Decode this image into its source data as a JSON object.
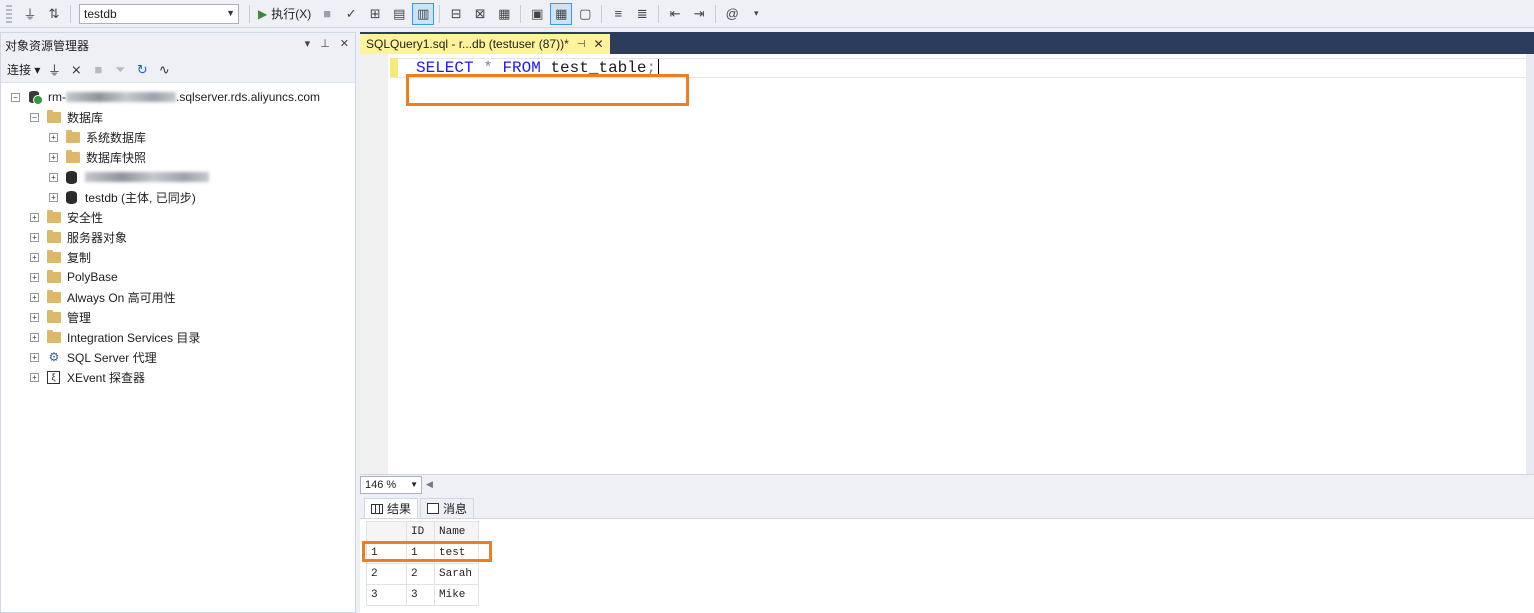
{
  "toolbar": {
    "database": "testdb",
    "execute_label": "执行(X)"
  },
  "object_explorer": {
    "title": "对象资源管理器",
    "connect_label": "连接",
    "server": {
      "name_prefix": "rm-",
      "name_suffix": ".sqlserver.rds.aliyuncs.com"
    },
    "databases_label": "数据库",
    "db_children": [
      {
        "label": "系统数据库"
      },
      {
        "label": "数据库快照"
      },
      {
        "label": ""
      },
      {
        "label": "testdb (主体, 已同步)"
      }
    ],
    "top_nodes": [
      {
        "label": "安全性"
      },
      {
        "label": "服务器对象"
      },
      {
        "label": "复制"
      },
      {
        "label": "PolyBase"
      },
      {
        "label": "Always On 高可用性"
      },
      {
        "label": "管理"
      },
      {
        "label": "Integration Services 目录"
      },
      {
        "label": "SQL Server 代理"
      },
      {
        "label": "XEvent 探查器"
      }
    ]
  },
  "editor": {
    "tab_title": "SQLQuery1.sql - r...db (testuser (87))*",
    "code": {
      "kw1": "SELECT",
      "star": "*",
      "kw2": "FROM",
      "table": "test_table",
      "semi": ";"
    },
    "zoom": "146 %"
  },
  "results": {
    "tabs": [
      {
        "label": "结果"
      },
      {
        "label": "消息"
      }
    ],
    "columns": [
      "",
      "ID",
      "Name"
    ],
    "rows": [
      [
        "1",
        "1",
        "test"
      ],
      [
        "2",
        "2",
        "Sarah"
      ],
      [
        "3",
        "3",
        "Mike"
      ]
    ]
  },
  "colors": {
    "highlight": "#ef7d22",
    "tab_active": "#fff29d",
    "chrome_dark": "#2c3c5c",
    "keyword": "#1a1aff"
  }
}
